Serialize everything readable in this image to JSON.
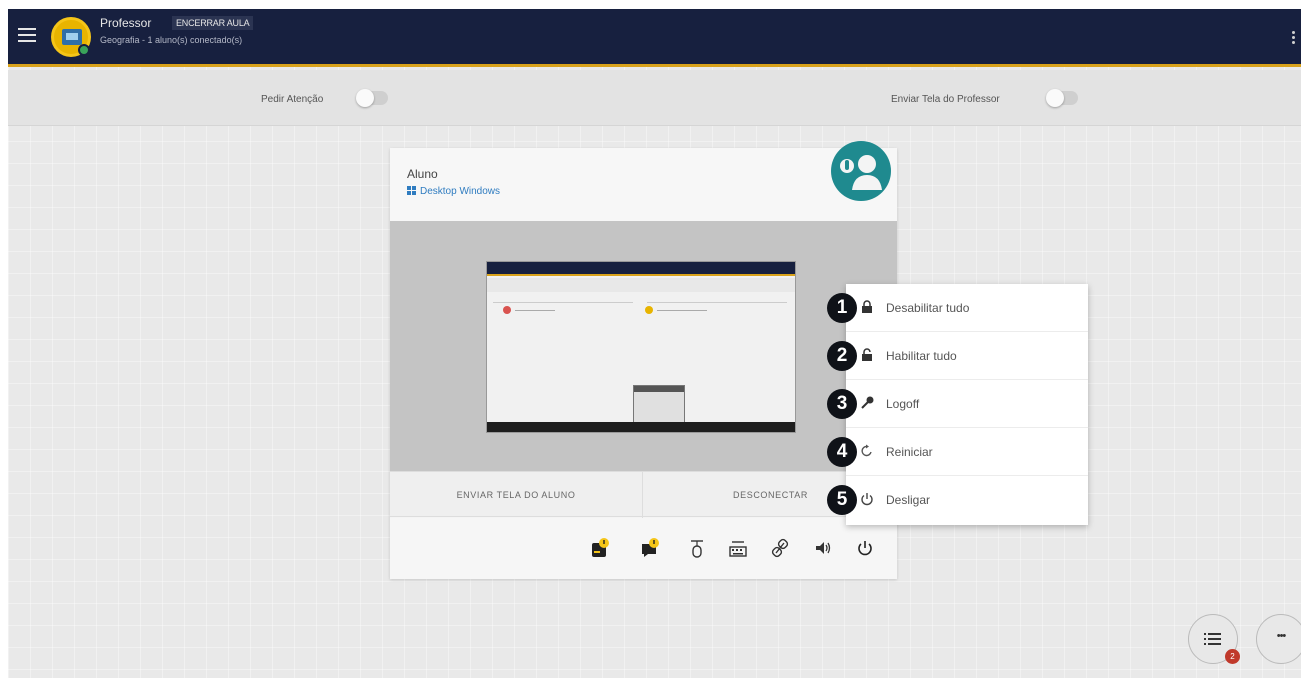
{
  "header": {
    "name": "Professor",
    "end_class_label": "ENCERRAR AULA",
    "subtitle": "Geografia - 1 aluno(s) conectado(s)"
  },
  "toolbar": {
    "attention_label": "Pedir Atenção",
    "send_screen_label": "Enviar Tela do Professor"
  },
  "student": {
    "name": "Aluno",
    "os": "Desktop Windows",
    "send_screen_label": "ENVIAR TELA DO ALUNO",
    "disconnect_label": "DESCONECTAR",
    "icons": [
      "block-screen-icon",
      "message-icon",
      "mouse-icon",
      "keyboard-icon",
      "link-icon",
      "volume-icon",
      "power-icon"
    ]
  },
  "power_menu": {
    "items": [
      {
        "number": "1",
        "label": "Desabilitar tudo",
        "icon": "lock-icon"
      },
      {
        "number": "2",
        "label": "Habilitar tudo",
        "icon": "unlock-icon"
      },
      {
        "number": "3",
        "label": "Logoff",
        "icon": "key-icon"
      },
      {
        "number": "4",
        "label": "Reiniciar",
        "icon": "restart-icon"
      },
      {
        "number": "5",
        "label": "Desligar",
        "icon": "power-icon"
      }
    ]
  },
  "fab": {
    "list_badge": "2",
    "more_glyph": "•••"
  },
  "colors": {
    "header_bg": "#17203f",
    "header_accent": "#d9a21b",
    "student_avatar": "#1f8a8f",
    "badge": "#c0392b"
  }
}
